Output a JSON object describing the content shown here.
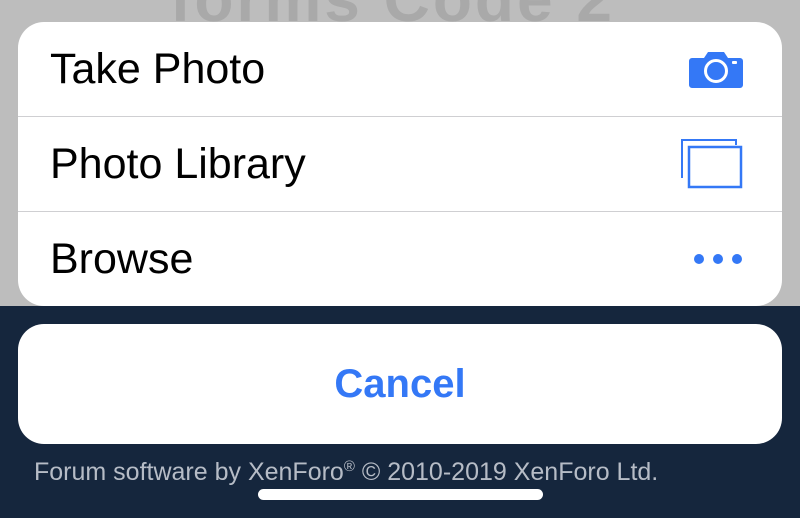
{
  "background": {
    "heading": "forms Code 2",
    "footer_prefix": "Forum software by XenForo",
    "footer_registered": "®",
    "footer_suffix": " © 2010-2019 XenForo Ltd."
  },
  "action_sheet": {
    "items": [
      {
        "label": "Take Photo",
        "icon": "camera-icon"
      },
      {
        "label": "Photo Library",
        "icon": "photo-library-icon"
      },
      {
        "label": "Browse",
        "icon": "more-icon"
      }
    ],
    "cancel_label": "Cancel"
  },
  "colors": {
    "accent": "#3478f6",
    "footer_bg": "#15263d",
    "dim_bg": "#bdbdbd"
  }
}
